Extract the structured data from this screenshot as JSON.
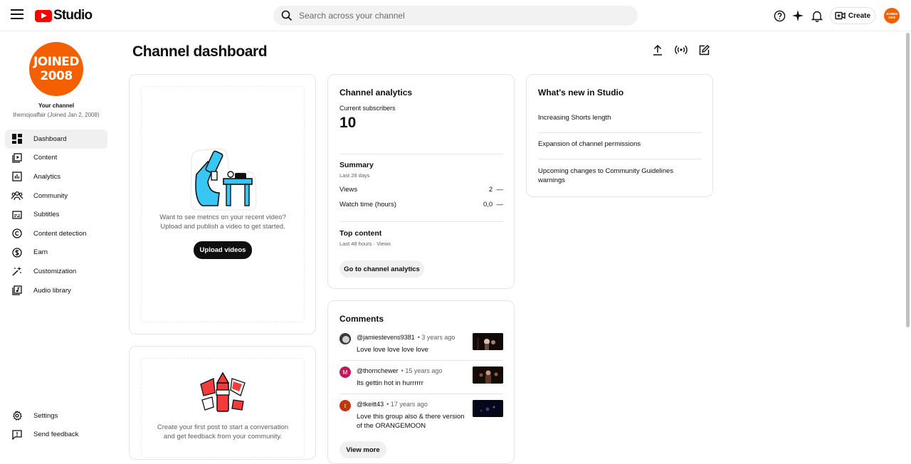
{
  "app": {
    "logo_text": "Studio",
    "search_placeholder": "Search across your channel",
    "create_label": "Create",
    "avatar_text": "JOINED 2008"
  },
  "sidebar": {
    "avatar_line1": "JOINED",
    "avatar_line2": "2008",
    "your_channel": "Your channel",
    "channel_name": "themojoaffair (Joined Jan 2, 2008)",
    "items": [
      {
        "label": "Dashboard",
        "icon": "dashboard-icon"
      },
      {
        "label": "Content",
        "icon": "content-icon"
      },
      {
        "label": "Analytics",
        "icon": "analytics-icon"
      },
      {
        "label": "Community",
        "icon": "community-icon"
      },
      {
        "label": "Subtitles",
        "icon": "subtitles-icon"
      },
      {
        "label": "Content detection",
        "icon": "copyright-icon"
      },
      {
        "label": "Earn",
        "icon": "dollar-icon"
      },
      {
        "label": "Customization",
        "icon": "magic-wand-icon"
      },
      {
        "label": "Audio library",
        "icon": "audio-library-icon"
      }
    ],
    "bottom_items": [
      {
        "label": "Settings",
        "icon": "gear-icon"
      },
      {
        "label": "Send feedback",
        "icon": "feedback-icon"
      }
    ]
  },
  "main": {
    "title": "Channel dashboard",
    "video_card": {
      "text_line1": "Want to see metrics on your recent video?",
      "text_line2": "Upload and publish a video to get started.",
      "button": "Upload videos"
    },
    "post_card": {
      "text_line1": "Create your first post to start a conversation",
      "text_line2": "and get feedback from your community."
    },
    "analytics": {
      "title": "Channel analytics",
      "subscribers_label": "Current subscribers",
      "subscribers_value": "10",
      "summary_title": "Summary",
      "summary_period": "Last 28 days",
      "metrics": [
        {
          "label": "Views",
          "value": "2",
          "trend": "—"
        },
        {
          "label": "Watch time (hours)",
          "value": "0,0",
          "trend": "—"
        }
      ],
      "top_content_title": "Top content",
      "top_content_period": "Last 48 hours · Views",
      "button": "Go to channel analytics"
    },
    "comments": {
      "title": "Comments",
      "items": [
        {
          "author": "@jamiestevens9381",
          "time": "• 3 years ago",
          "text": "Love love love love love",
          "avatar_letter": "",
          "avatar_color": "#5a5a5a"
        },
        {
          "author": "@thornchewer",
          "time": "• 15 years ago",
          "text": "Its gettin hot in hurrrrrr",
          "avatar_letter": "M",
          "avatar_color": "#c2185b"
        },
        {
          "author": "@tkeitt43",
          "time": "• 17 years ago",
          "text": "Love this group also & there version of the ORANGEMOON",
          "avatar_letter": "t",
          "avatar_color": "#bf360c"
        }
      ],
      "view_more": "View more"
    },
    "whats_new": {
      "title": "What's new in Studio",
      "items": [
        "Increasing Shorts length",
        "Expansion of channel permissions",
        "Upcoming changes to Community Guidelines warnings"
      ]
    }
  },
  "colors": {
    "accent_red": "#ff0000",
    "avatar_orange": "#f45f02",
    "illustration_blue": "#38c6f4",
    "illustration_red": "#f23b3b"
  }
}
